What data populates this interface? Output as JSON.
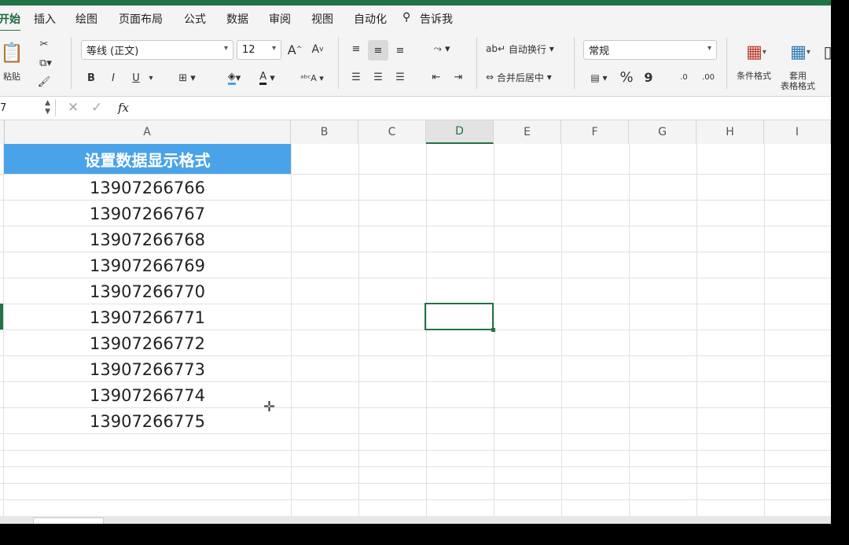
{
  "tabs": [
    "开始",
    "插入",
    "绘图",
    "页面布局",
    "公式",
    "数据",
    "审阅",
    "视图",
    "自动化",
    "告诉我"
  ],
  "clipboard": {
    "paste_label": "粘贴"
  },
  "font": {
    "name": "等线 (正文)",
    "size": "12",
    "bold": "B",
    "italic": "I",
    "underline": "U",
    "increase": "A",
    "decrease": "A",
    "font_color": "A"
  },
  "alignment": {
    "wrap_label": "自动换行",
    "merge_label": "合并后居中"
  },
  "number": {
    "format": "常规",
    "percent": "%",
    "comma": "9",
    "inc_decimal": ".0",
    "dec_decimal": ".00"
  },
  "styles": {
    "conditional_label": "条件格式",
    "table_label_1": "套用",
    "table_label_2": "表格格式"
  },
  "formula_bar": {
    "name_box": "7",
    "fx": "fx",
    "value": ""
  },
  "columns": [
    "A",
    "B",
    "C",
    "D",
    "E",
    "F",
    "G",
    "H",
    "I"
  ],
  "active_column": "D",
  "sheet": {
    "header": "设置数据显示格式",
    "values": [
      "13907266766",
      "13907266767",
      "13907266768",
      "13907266769",
      "13907266770",
      "13907266771",
      "13907266772",
      "13907266773",
      "13907266774",
      "13907266775"
    ]
  },
  "colors": {
    "accent": "#217346",
    "header_fill": "#4aa3e8"
  }
}
